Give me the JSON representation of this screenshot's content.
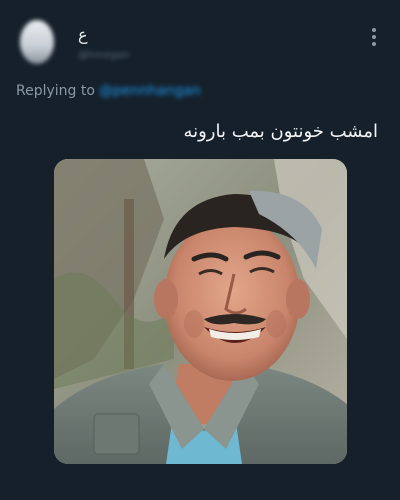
{
  "author": {
    "display_name": "ع",
    "handle": "@hmegan"
  },
  "reply": {
    "label": "Replying to",
    "mention": "@pennhangan"
  },
  "tweet": {
    "text": "امشب خونتون بمب بارونه"
  },
  "media": {
    "description": "photo"
  },
  "icons": {
    "menu": "more-vertical-icon"
  },
  "colors": {
    "background": "#15202b",
    "accent": "#1d9bf0",
    "text": "#f2f3f4",
    "muted": "#8b98a5"
  }
}
